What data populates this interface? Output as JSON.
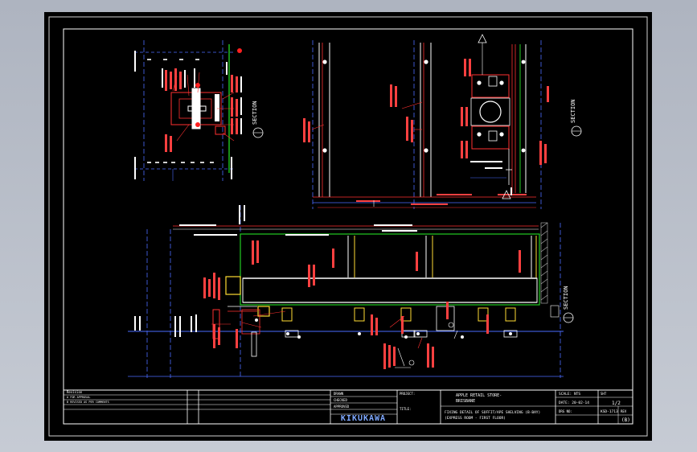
{
  "sections": {
    "section_a_label": "SECTION",
    "section_b_label": "SECTION",
    "section_c_label": "SECTION"
  },
  "title_block": {
    "logo": "KIKUKAWA",
    "project_label": "PROJECT:",
    "project_name_line1": "APPLE RETAIL STORE-",
    "project_name_line2": "BRISBANE",
    "title_label": "TITLE:",
    "title_line1": "FIXING DETAIL OF SOFFIT/APE SHELVING (B-BAY)",
    "title_line2": "(EXPRESS ROOM - FIRST FLOOR)",
    "scale_label": "SCALE: NTS",
    "date": "DATE: 20-02-14",
    "sheet_label": "SHT",
    "sheet_no": "1/2",
    "drawing_no_label": "DRG NO:",
    "drawing_no": "KSD-1713",
    "revision_label": "REV",
    "revision": "(B)",
    "revisions_header": "Revision",
    "revision_rows": [
      "A  FOR APPROVAL",
      "B  REVISED AS PER COMMENTS"
    ],
    "signature_rows": [
      "DRAWN",
      "CHECKED",
      "APPROVED"
    ]
  }
}
